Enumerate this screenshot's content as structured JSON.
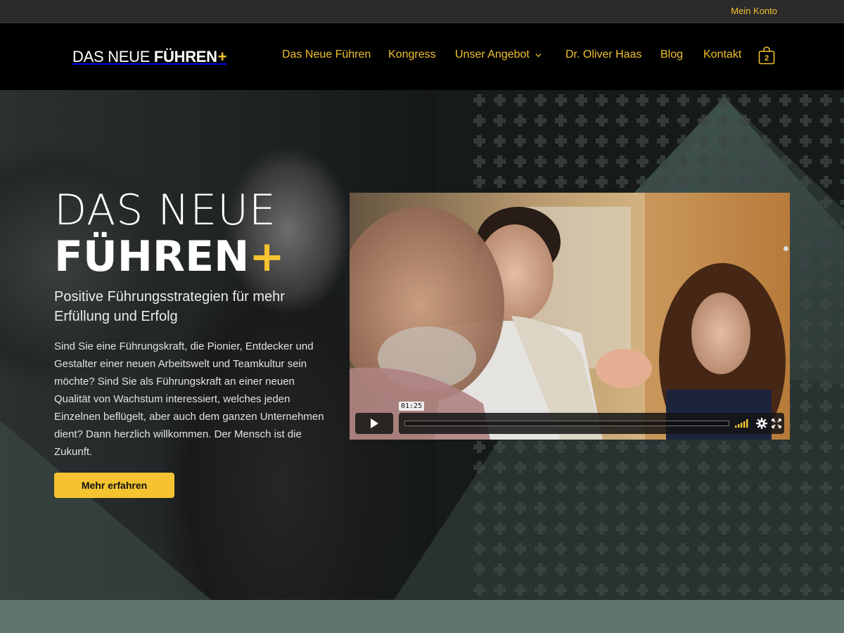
{
  "topbar": {
    "account_label": "Mein Konto"
  },
  "header": {
    "logo": {
      "part1": "DAS NEUE ",
      "part2": "FÜHREN",
      "plus": "+"
    },
    "nav": [
      {
        "label": "Das Neue Führen",
        "active": true
      },
      {
        "label": "Kongress"
      },
      {
        "label": "Unser Angebot",
        "has_dropdown": true
      },
      {
        "label": "Dr. Oliver Haas"
      },
      {
        "label": "Blog"
      },
      {
        "label": "Kontakt"
      }
    ],
    "cart_count": "2"
  },
  "hero": {
    "title_line1": "DAS NEUE",
    "title_line2": "FÜHREN",
    "title_plus": "+",
    "subtitle": "Positive Führungsstrategien für mehr Erfüllung und Erfolg",
    "body": "Sind Sie eine Führungskraft, die Pionier, Entdecker und Gestalter einer neuen Arbeitswelt und Teamkultur sein möchte? Sind Sie als Führungskraft an einer neuen Qualität von Wachstum interessiert, welches jeden Einzelnen beflügelt, aber auch dem ganzen Unternehmen dient? Dann herzlich willkommen. Der Mensch ist die Zukunft.",
    "cta_label": "Mehr erfahren"
  },
  "video": {
    "time": "01:25",
    "progress": 0
  },
  "colors": {
    "accent": "#f5c330",
    "teal": "#5f756d",
    "bg": "#000000"
  }
}
